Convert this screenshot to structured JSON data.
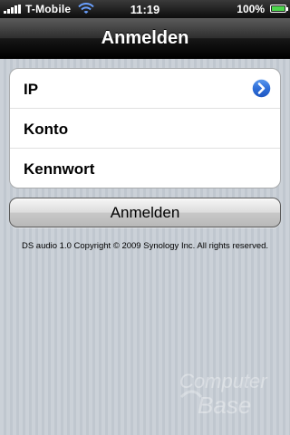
{
  "status_bar": {
    "carrier": "T-Mobile",
    "time": "11:19",
    "battery": "100%",
    "battery_level": 1.0,
    "signal_bars": 5
  },
  "nav_bar": {
    "title": "Anmelden"
  },
  "login_form": {
    "rows": [
      {
        "label": "IP",
        "has_disclosure": true
      },
      {
        "label": "Konto",
        "has_disclosure": false
      },
      {
        "label": "Kennwort",
        "has_disclosure": false
      }
    ],
    "disclosure_icon": "chevron-right-circle-icon",
    "disclosure_color": "#2f6fd8"
  },
  "login_button": {
    "label": "Anmelden"
  },
  "footer": {
    "copyright": "DS audio 1.0  Copyright © 2009 Synology Inc. All rights reserved."
  },
  "watermark": {
    "text_top": "Computer",
    "text_bottom": "Base"
  },
  "colors": {
    "background": "#c5ccd4",
    "nav_bar": "#000000"
  }
}
